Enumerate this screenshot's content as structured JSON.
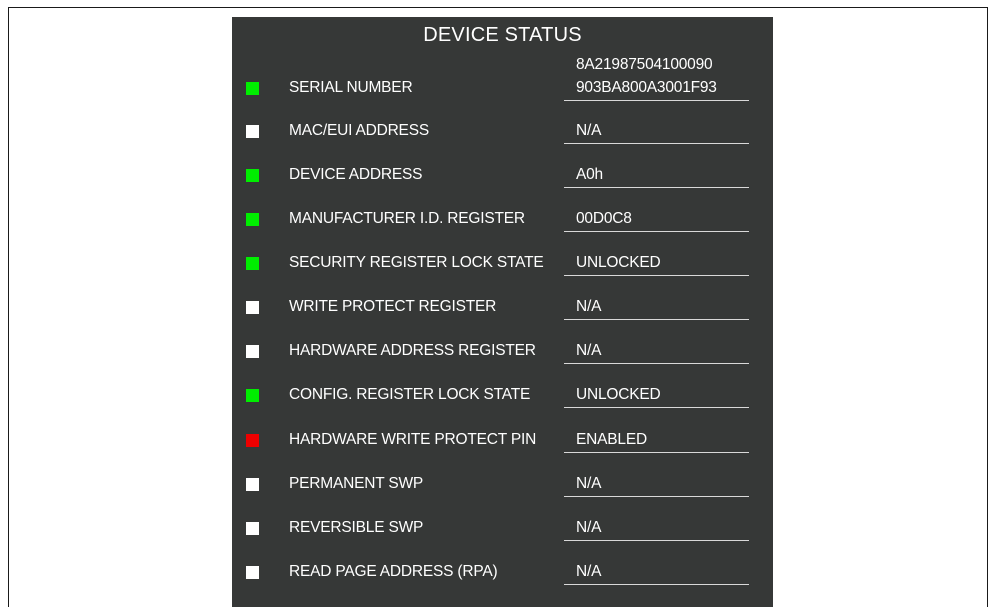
{
  "panel": {
    "title": "DEVICE STATUS"
  },
  "colors": {
    "ok": "#00ee00",
    "na": "#ffffff",
    "alert": "#ee0000"
  },
  "serial": {
    "label": "SERIAL NUMBER",
    "value_line1": "8A21987504100090",
    "value_line2": "903BA800A3001F93",
    "status": "ok"
  },
  "rows": [
    {
      "label": "MAC/EUI ADDRESS",
      "value": "N/A",
      "status": "na"
    },
    {
      "label": "DEVICE ADDRESS",
      "value": "A0h",
      "status": "ok"
    },
    {
      "label": "MANUFACTURER I.D. REGISTER",
      "value": "00D0C8",
      "status": "ok"
    },
    {
      "label": "SECURITY REGISTER LOCK STATE",
      "value": "UNLOCKED",
      "status": "ok"
    },
    {
      "label": "WRITE PROTECT REGISTER",
      "value": "N/A",
      "status": "na"
    },
    {
      "label": "HARDWARE ADDRESS REGISTER",
      "value": "N/A",
      "status": "na"
    },
    {
      "label": "CONFIG. REGISTER LOCK STATE",
      "value": "UNLOCKED",
      "status": "ok"
    },
    {
      "label": "HARDWARE WRITE PROTECT PIN",
      "value": "ENABLED",
      "status": "alert"
    },
    {
      "label": "PERMANENT SWP",
      "value": "N/A",
      "status": "na"
    },
    {
      "label": "REVERSIBLE SWP",
      "value": "N/A",
      "status": "na"
    },
    {
      "label": "READ PAGE ADDRESS (RPA)",
      "value": "N/A",
      "status": "na"
    }
  ]
}
